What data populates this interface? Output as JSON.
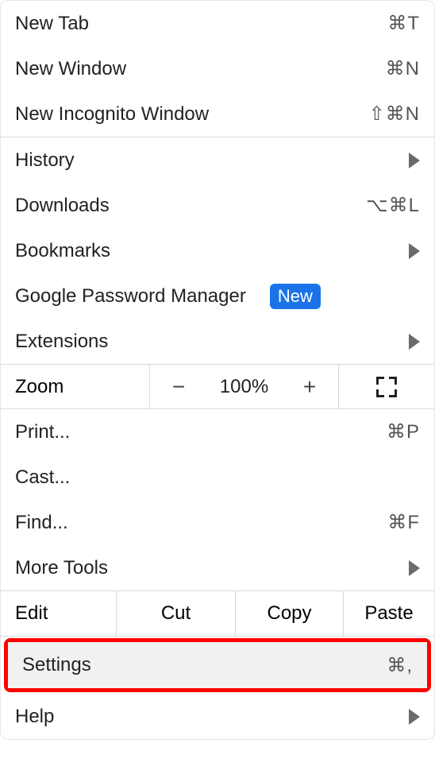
{
  "items": {
    "new_tab": {
      "label": "New Tab",
      "shortcut": "⌘T"
    },
    "new_window": {
      "label": "New Window",
      "shortcut": "⌘N"
    },
    "new_incognito": {
      "label": "New Incognito Window",
      "shortcut": "⇧⌘N"
    },
    "history": {
      "label": "History"
    },
    "downloads": {
      "label": "Downloads",
      "shortcut": "⌥⌘L"
    },
    "bookmarks": {
      "label": "Bookmarks"
    },
    "gpm": {
      "label": "Google Password Manager",
      "badge": "New"
    },
    "extensions": {
      "label": "Extensions"
    },
    "zoom": {
      "label": "Zoom",
      "minus": "−",
      "value": "100%",
      "plus": "+"
    },
    "print": {
      "label": "Print...",
      "shortcut": "⌘P"
    },
    "cast": {
      "label": "Cast..."
    },
    "find": {
      "label": "Find...",
      "shortcut": "⌘F"
    },
    "more_tools": {
      "label": "More Tools"
    },
    "edit": {
      "label": "Edit",
      "cut": "Cut",
      "copy": "Copy",
      "paste": "Paste"
    },
    "settings": {
      "label": "Settings",
      "shortcut": "⌘,"
    },
    "help": {
      "label": "Help"
    }
  }
}
